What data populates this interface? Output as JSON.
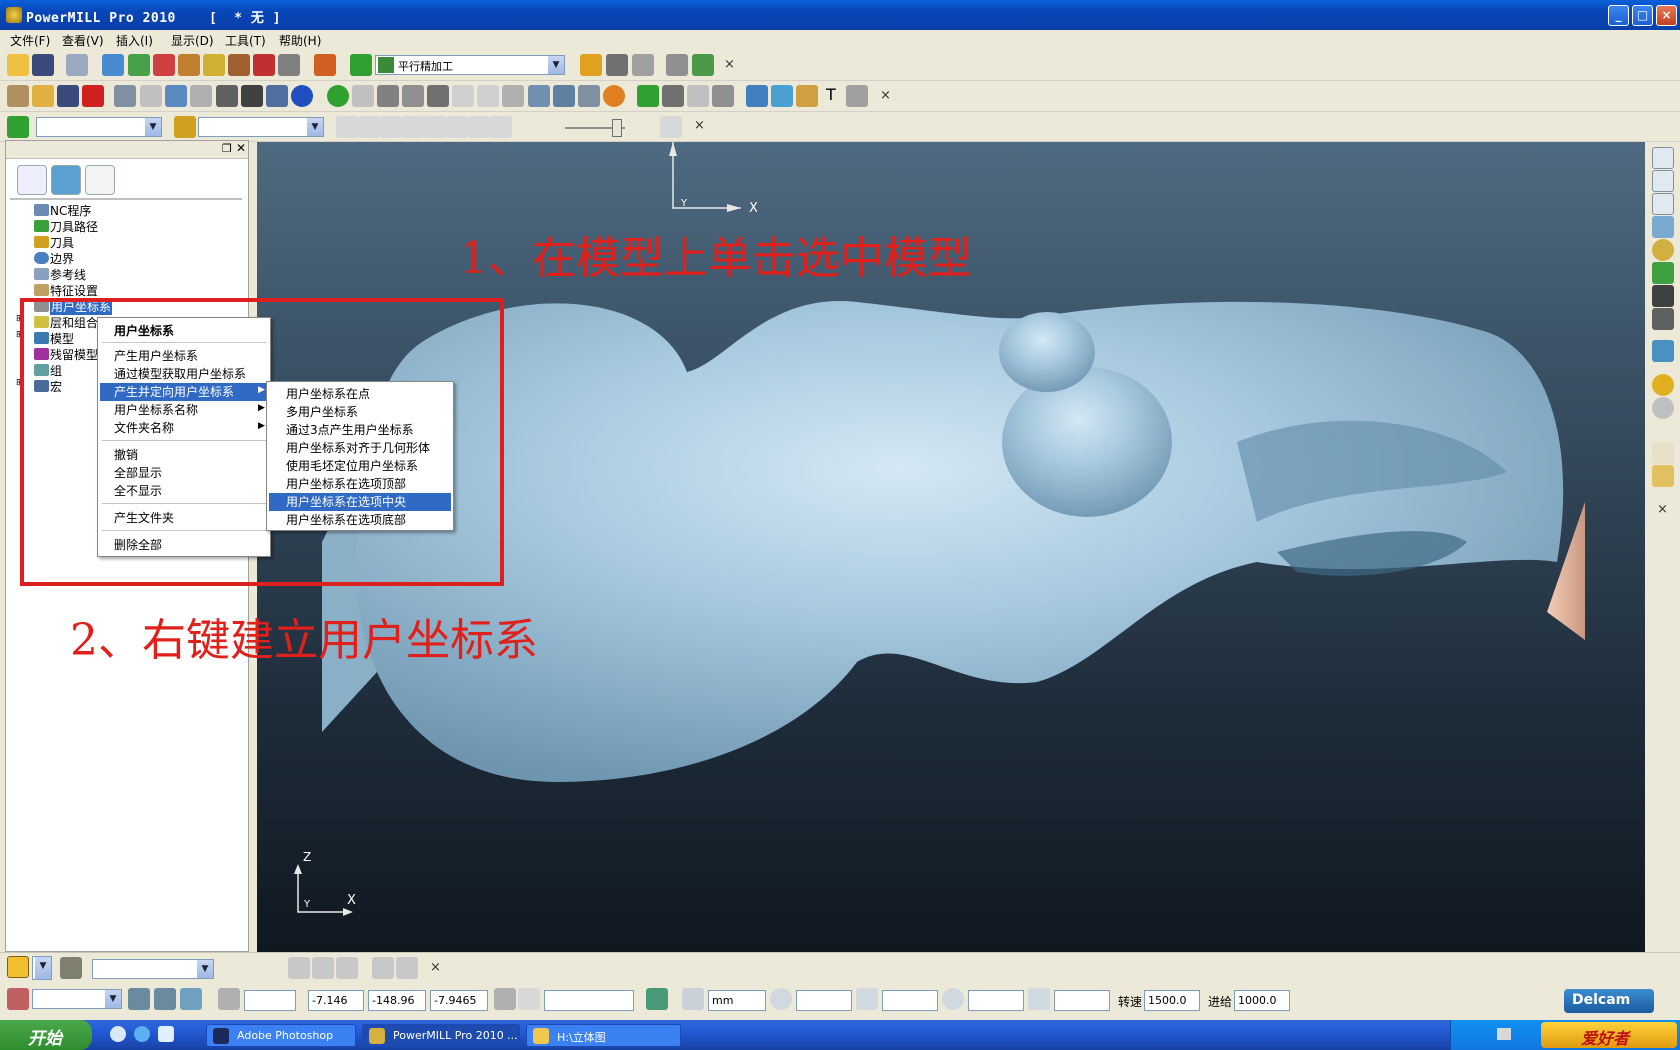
{
  "window": {
    "title": "PowerMILL Pro 2010    [  * 无 ]",
    "minimize": "_",
    "maximize": "□",
    "close": "×"
  },
  "menubar": [
    "文件(F)",
    "查看(V)",
    "插入(I)",
    "显示(D)",
    "工具(T)",
    "帮助(H)"
  ],
  "toolbar1": {
    "strategy_value": "平行精加工",
    "close": "×"
  },
  "toolbar2": {
    "text_tool": "T",
    "close": "×"
  },
  "toolbar3": {
    "close": "×"
  },
  "explorer": {
    "items": [
      {
        "label": "NC程序",
        "icon": "nc-program-icon"
      },
      {
        "label": "刀具路径",
        "icon": "toolpath-icon"
      },
      {
        "label": "刀具",
        "icon": "tool-icon"
      },
      {
        "label": "边界",
        "icon": "boundary-icon"
      },
      {
        "label": "参考线",
        "icon": "pattern-icon"
      },
      {
        "label": "特征设置",
        "icon": "feature-icon"
      },
      {
        "label": "用户坐标系",
        "icon": "workplane-icon"
      },
      {
        "label": "层和组合",
        "icon": "layer-icon"
      },
      {
        "label": "模型",
        "icon": "model-icon"
      },
      {
        "label": "残留模型",
        "icon": "stock-model-icon"
      },
      {
        "label": "组",
        "icon": "group-icon"
      },
      {
        "label": "宏",
        "icon": "macro-icon"
      }
    ]
  },
  "context_menu": {
    "title": "用户坐标系",
    "items": [
      "产生用户坐标系",
      "通过模型获取用户坐标系",
      "产生并定向用户坐标系",
      "用户坐标系名称",
      "文件夹名称",
      "撤销",
      "全部显示",
      "全不显示",
      "产生文件夹",
      "删除全部"
    ]
  },
  "submenu": {
    "items": [
      "用户坐标系在点",
      "多用户坐标系",
      "通过3点产生用户坐标系",
      "用户坐标系对齐于几何形体",
      "使用毛坯定位用户坐标系",
      "用户坐标系在选项顶部",
      "用户坐标系在选项中央",
      "用户坐标系在选项底部"
    ]
  },
  "annotations": {
    "step1": "1、在模型上单击选中模型",
    "step2": "2、右键建立用户坐标系"
  },
  "viewport": {
    "axis_top": {
      "x": "X",
      "y": "Y"
    },
    "axis_bottom": {
      "z": "Z",
      "y": "Y",
      "x": "X"
    }
  },
  "statusbar": {
    "close": "×",
    "coord_x": "-7.146",
    "coord_y": "-148.96",
    "coord_z": "-7.9465",
    "units": "mm",
    "spindle_label": "转速",
    "spindle_value": "1500.0",
    "feed_label": "进给",
    "feed_value": "1000.0",
    "brand": "Delcam"
  },
  "taskbar": {
    "start": "开始",
    "tasks": [
      "Adobe Photoshop",
      "PowerMILL Pro 2010 ...",
      "H:\\立体图"
    ],
    "tray_logo": "爱好者"
  }
}
